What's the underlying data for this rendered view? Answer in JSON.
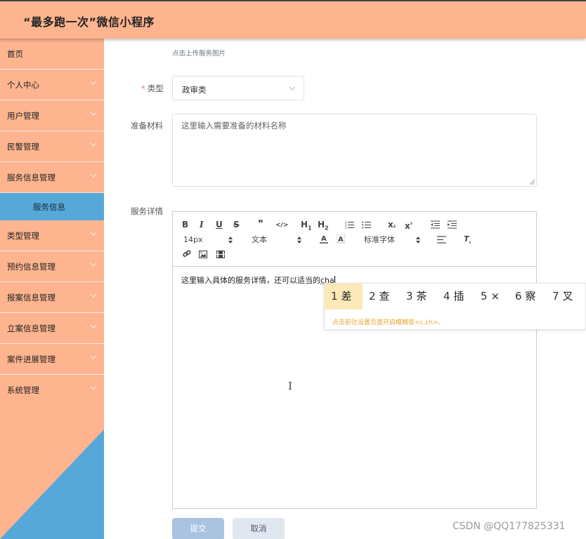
{
  "header": {
    "title": "“最多跑一次”微信小程序"
  },
  "sidebar": {
    "items": [
      {
        "label": "首页",
        "has_children": false
      },
      {
        "label": "个人中心",
        "has_children": true
      },
      {
        "label": "用户管理",
        "has_children": true
      },
      {
        "label": "民警管理",
        "has_children": true
      },
      {
        "label": "服务信息管理",
        "has_children": true
      },
      {
        "label": "类型管理",
        "has_children": true
      },
      {
        "label": "预约信息管理",
        "has_children": true
      },
      {
        "label": "报案信息管理",
        "has_children": true
      },
      {
        "label": "立案信息管理",
        "has_children": true
      },
      {
        "label": "案件进展管理",
        "has_children": true
      },
      {
        "label": "系统管理",
        "has_children": true
      }
    ],
    "active_sub": "服务信息",
    "colors": {
      "bg": "#fdb48f",
      "active": "#55a8d7"
    }
  },
  "form": {
    "upload_hint": "点击上传服务图片",
    "type_label": "类型",
    "required_mark": "*",
    "type_value": "政审类",
    "materials_label": "准备材料",
    "materials_placeholder": "这里输入需要准备的材料名称",
    "details_label": "服务详情",
    "submit_label": "提交",
    "cancel_label": "取消"
  },
  "editor": {
    "toolbar": {
      "bold": "B",
      "italic": "I",
      "underline": "U",
      "strike": "S",
      "quote": "❞",
      "code": "</>",
      "h1": "H",
      "h1_sub": "1",
      "h2": "H",
      "h2_sub": "2",
      "subscript": "x",
      "subscript_mark": "₂",
      "superscript": "x",
      "superscript_mark": "²",
      "font_size": "14px",
      "text_style": "文本",
      "font_family": "标准字体"
    },
    "content_text": "这里输入具体的服务详情，还可以适当的",
    "ime_composition": "cha"
  },
  "ime": {
    "candidates": [
      {
        "n": "1",
        "ch": "差"
      },
      {
        "n": "2",
        "ch": "查"
      },
      {
        "n": "3",
        "ch": "茶"
      },
      {
        "n": "4",
        "ch": "插"
      },
      {
        "n": "5",
        "ch": "×"
      },
      {
        "n": "6",
        "ch": "察"
      },
      {
        "n": "7",
        "ch": "叉"
      }
    ],
    "tip": "点击前往设置页面开启模糊音<c,ch>。"
  },
  "watermark": "CSDN @QQ177825331"
}
